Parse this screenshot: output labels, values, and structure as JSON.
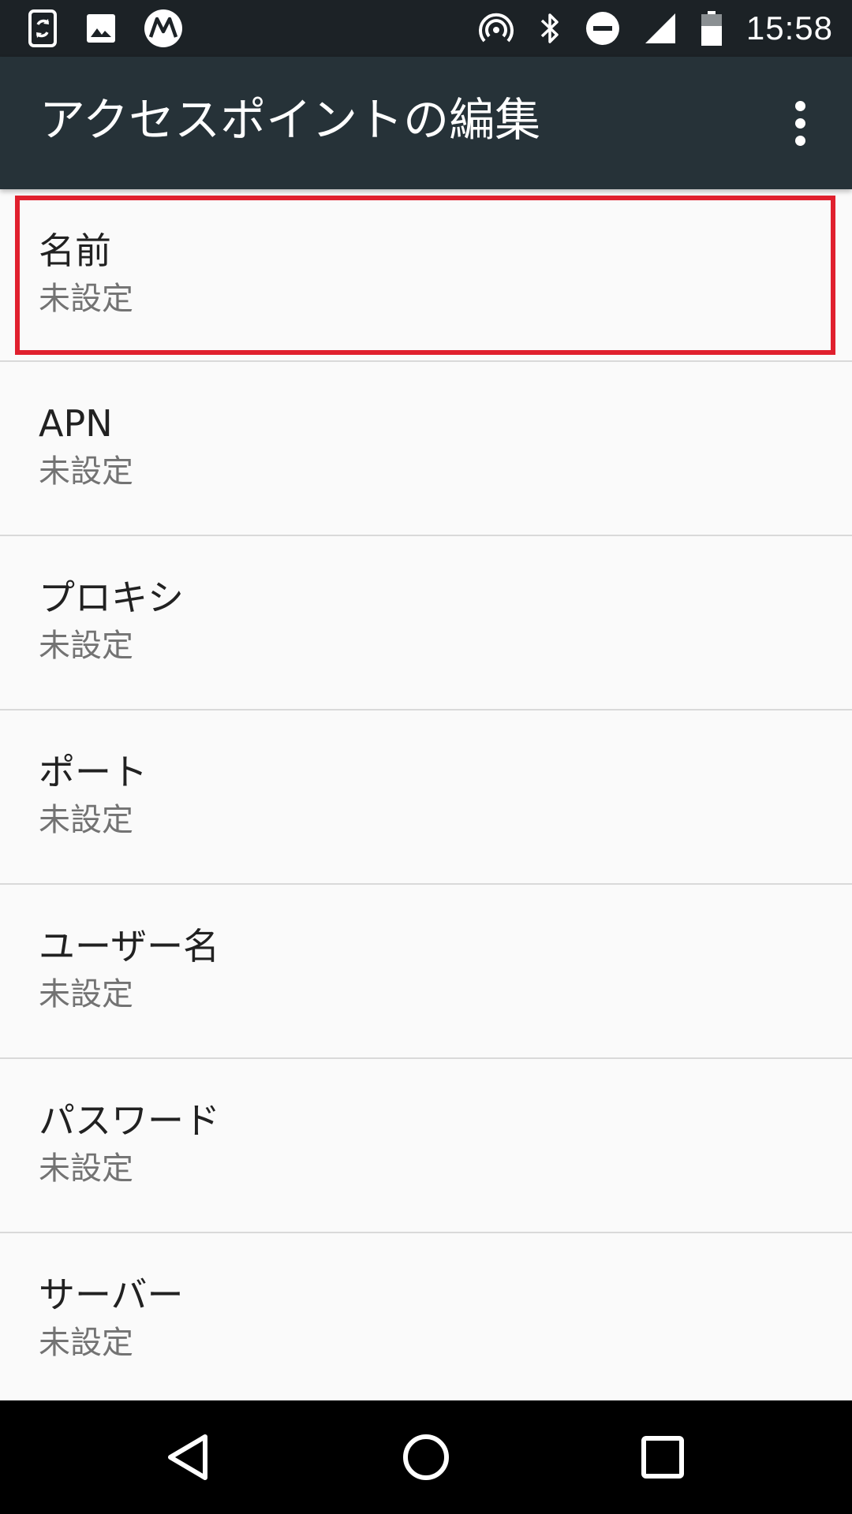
{
  "status_bar": {
    "time": "15:58",
    "left_icons": [
      "screen-rotation-icon",
      "gallery-icon",
      "motorola-logo-icon"
    ],
    "right_icons": [
      "hotspot-icon",
      "bluetooth-icon",
      "do-not-disturb-icon",
      "signal-icon",
      "battery-icon"
    ]
  },
  "app_bar": {
    "title": "アクセスポイントの編集",
    "overflow_icon": "more-vert-icon"
  },
  "settings": [
    {
      "title": "名前",
      "summary": "未設定"
    },
    {
      "title": "APN",
      "summary": "未設定"
    },
    {
      "title": "プロキシ",
      "summary": "未設定"
    },
    {
      "title": "ポート",
      "summary": "未設定"
    },
    {
      "title": "ユーザー名",
      "summary": "未設定"
    },
    {
      "title": "パスワード",
      "summary": "未設定"
    },
    {
      "title": "サーバー",
      "summary": "未設定"
    }
  ],
  "highlight_color": "#e0202e",
  "nav_bar": {
    "icons": [
      "back-icon",
      "home-icon",
      "recents-icon"
    ]
  },
  "colors": {
    "status_bar": "#1c2226",
    "app_bar": "#263238",
    "background": "#fafafa",
    "divider": "#d9d9d9"
  }
}
